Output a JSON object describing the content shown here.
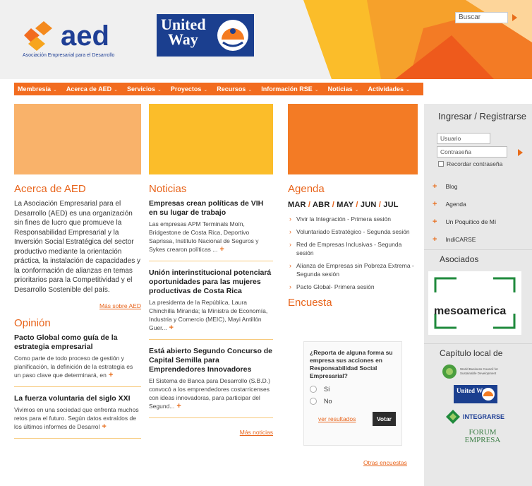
{
  "header": {
    "aed_logo_text": "aed",
    "aed_tagline": "Asociación Empresarial para el Desarrollo",
    "uw_line1": "United",
    "uw_line2": "Way",
    "search_label": "Buscar"
  },
  "nav": {
    "items": [
      "Membresía",
      "Acerca de AED",
      "Servicios",
      "Proyectos",
      "Recursos",
      "Información RSE",
      "Noticias",
      "Actividades"
    ]
  },
  "about": {
    "heading": "Acerca de AED",
    "text": "La Asociación Empresarial para el Desarrollo (AED) es una organización sin fines de lucro que promueve la Responsabilidad Empresarial y la Inversión Social Estratégica del sector productivo mediante la orientación práctica, la instalación de capacidades y la conformación de alianzas en temas prioritarios para la Competitividad y el Desarrollo Sostenible del país.",
    "more_link": "Más sobre AED"
  },
  "opinion": {
    "heading": "Opinión",
    "items": [
      {
        "title": "Pacto Global como guía de la estrategia empresarial",
        "body": "Como parte de todo proceso de gestión y planificación, la definición de la estrategia es un paso clave que determinará, en"
      },
      {
        "title": "La fuerza voluntaria del siglo XXI",
        "body": "Vivimos en una sociedad que enfrenta muchos retos para el futuro. Según datos extraídos de los últimos informes de Desarrol"
      }
    ]
  },
  "news": {
    "heading": "Noticias",
    "items": [
      {
        "title": "Empresas crean políticas de VIH en su lugar de trabajo",
        "body": "Las empresas APM Terminals Moín, Bridgestone de Costa Rica, Deportivo Saprissa, Instituto Nacional de Seguros y Sykes crearon políticas ..."
      },
      {
        "title": "Unión interinstitucional potenciará oportunidades para las mujeres productivas de Costa Rica",
        "body": "La presidenta de la República, Laura Chinchilla Miranda; la Ministra de Economía, Industria y Comercio (MEIC), Mayi Antillón Guer..."
      },
      {
        "title": "Está abierto Segundo Concurso de Capital Semilla para Emprendedores Innovadores",
        "body": "El Sistema de Banca para Desarrollo (S.B.D.) convocó a los emprendedores costarricenses con ideas innovadoras, para participar del Segund..."
      }
    ],
    "more_link": "Más noticias"
  },
  "agenda": {
    "heading": "Agenda",
    "months": [
      "MAR",
      "ABR",
      "MAY",
      "JUN",
      "JUL"
    ],
    "items": [
      "Vivir la Integración - Primera sesión",
      "Voluntariado Estratégico - Segunda sesión",
      "Red de Empresas Inclusivas - Segunda sesión",
      "Alianza de Empresas sin Pobreza Extrema - Segunda sesión",
      "Pacto Global- Primera sesión"
    ]
  },
  "poll": {
    "heading": "Encuesta",
    "question": "¿Reporta de alguna forma su empresa sus acciones en Responsabilidad Social Empresarial?",
    "options": [
      "Sí",
      "No"
    ],
    "results_link": "ver resultados",
    "vote_button": "Votar",
    "other_link": "Otras encuestas"
  },
  "sidebar": {
    "login_title": "Ingresar / Registrarse",
    "user_placeholder": "Usuario",
    "password_placeholder": "Contraseña",
    "remember": "Recordar contraseña",
    "links": [
      "Blog",
      "Agenda",
      "Un Poquitico de Mí",
      "IndiCARSE"
    ],
    "associates_heading": "Asociados",
    "associate_name": "mesoamerica",
    "chapter_heading": "Capítulo local de",
    "chapter_logos": [
      "World Business Council for Sustainable Development",
      "United Way",
      "INTEGRARSE",
      "FORUM EMPRESA"
    ]
  },
  "colors": {
    "accent": "#f26c1f",
    "heading_orange": "#e8641b",
    "block_left": "#f9b26a",
    "block_mid": "#fbbd2a",
    "block_right": "#f37b25"
  }
}
